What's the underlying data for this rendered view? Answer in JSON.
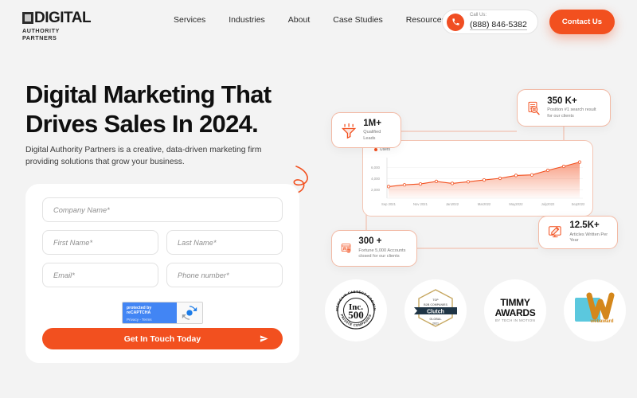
{
  "brand": {
    "logo_main": "DIGITAL",
    "logo_sub": "AUTHORITY PARTNERS",
    "accent": "#F2501F",
    "accent_light": "#F7A488",
    "page_bg": "#F3F3F3"
  },
  "header": {
    "nav": [
      {
        "label": "Services"
      },
      {
        "label": "Industries"
      },
      {
        "label": "About"
      },
      {
        "label": "Case Studies"
      },
      {
        "label": "Resources"
      }
    ],
    "call": {
      "label": "Call Us:",
      "number": "(888) 846-5382",
      "icon": "phone-icon"
    },
    "cta": {
      "label": "Contact Us"
    }
  },
  "hero": {
    "title_line1": "Digital Marketing That",
    "title_line2": "Drives Sales In 2024.",
    "subtitle": "Digital Authority Partners is a creative, data-driven marketing firm providing solutions that grow your business."
  },
  "form": {
    "fields": [
      {
        "name": "company-name",
        "placeholder": "Company Name*"
      },
      {
        "name": "first-name",
        "placeholder": "First Name*"
      },
      {
        "name": "last-name",
        "placeholder": "Last Name*"
      },
      {
        "name": "email",
        "placeholder": "Email*"
      },
      {
        "name": "phone-number",
        "placeholder": "Phone number*"
      }
    ],
    "recaptcha": {
      "protected_by": "protected by ",
      "brand": "reCAPTCHA",
      "links": "Privacy - Terms"
    },
    "submit_label": "Get In Touch Today"
  },
  "stats": [
    {
      "key": "qualified-leads",
      "value": "1M+",
      "desc": "Qualified Leads",
      "icon": "funnel-icon"
    },
    {
      "key": "search-results",
      "value": "350 K+",
      "desc": "Position #1 search result for our clients",
      "icon": "document-search-icon"
    },
    {
      "key": "articles-written",
      "value": "12.5K+",
      "desc": "Articles Written Per Year",
      "icon": "monitor-pen-icon"
    },
    {
      "key": "fortune-accounts",
      "value": "300 +",
      "desc": "Fortune 5,000 Accounts closed for our clients",
      "icon": "account-card-icon"
    }
  ],
  "chart_data": {
    "type": "area",
    "title": "",
    "xlabel": "",
    "ylabel": "",
    "legend": [
      "Users"
    ],
    "legend_position": "top-left",
    "grid": true,
    "ylim": [
      0,
      7000
    ],
    "yticks": [
      "2,000",
      "4,000",
      "6,000"
    ],
    "ytick_values": [
      2000,
      4000,
      6000
    ],
    "categories": [
      "Sep 2021",
      "Nov 2021",
      "Jan2022",
      "Mar2022",
      "May2022",
      "July2022",
      "Sep2022"
    ],
    "x": [
      "Sep 2021",
      "Oct 2021",
      "Nov 2021",
      "Dec 2021",
      "Jan 2022",
      "Feb 2022",
      "Mar 2022",
      "Apr 2022",
      "May 2022",
      "Jun 2022",
      "July 2022",
      "Aug 2022",
      "Sep 2022"
    ],
    "series": [
      {
        "name": "Users",
        "color": "#F2501F",
        "values": [
          2050,
          2350,
          2500,
          2950,
          2600,
          2900,
          3200,
          3500,
          4000,
          4100,
          4900,
          5600,
          6350
        ]
      }
    ]
  },
  "awards": [
    {
      "key": "inc-500",
      "name": "inc-500-badge",
      "main": "Inc.",
      "number": "500",
      "ring_top": "AMERICA'S FASTEST GROWING",
      "ring_bottom": "PRIVATE COMPANIES"
    },
    {
      "key": "clutch",
      "name": "clutch-badge",
      "line1": "TOP",
      "line2": "B2B COMPANIES",
      "main": "Clutch",
      "line3": "GLOBAL",
      "line4": "2021"
    },
    {
      "key": "timmy",
      "name": "timmy-awards-badge",
      "line1": "TIMMY",
      "line2": "AWARDS",
      "line3": "BY TECH IN MOTION"
    },
    {
      "key": "webaward",
      "name": "webaward-badge",
      "letter": "W",
      "label": "webaward"
    }
  ]
}
